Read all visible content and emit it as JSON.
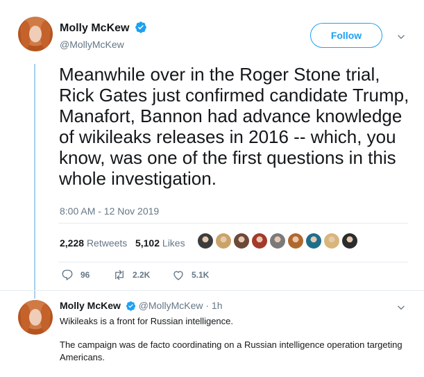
{
  "tweet": {
    "author_name": "Molly McKew",
    "author_handle": "@MollyMcKew",
    "follow_label": "Follow",
    "text": "Meanwhile over in the Roger Stone trial, Rick Gates just confirmed candidate Trump, Manafort, Bannon had advance knowledge of wikileaks releases in 2016 -- which, you know, was one of the first questions in this whole investigation.",
    "timestamp": "8:00 AM - 12 Nov 2019",
    "retweets_count": "2,228",
    "retweets_label": "Retweets",
    "likes_count": "5,102",
    "likes_label": "Likes",
    "actions": {
      "reply_count": "96",
      "retweet_count": "2.2K",
      "like_count": "5.1K"
    },
    "liker_colors": [
      "#3c3c3c",
      "#c9a36a",
      "#6b4a3a",
      "#a33a2a",
      "#7a7a7a",
      "#b0682c",
      "#1d6e8c",
      "#d8b57a",
      "#2c2c2c"
    ]
  },
  "reply": {
    "author_name": "Molly McKew",
    "author_handle": "@MollyMcKew",
    "time": "· 1h",
    "text_line1": "Wikileaks is a front for Russian intelligence.",
    "text_line2": "The campaign was de facto coordinating on a Russian intelligence operation targeting Americans."
  },
  "colors": {
    "accent": "#1da1f2",
    "secondary_text": "#657786",
    "thread_line": "#a5d0ee"
  },
  "icons": [
    "verified-badge-icon",
    "chevron-down-icon",
    "reply-icon",
    "retweet-icon",
    "like-icon"
  ]
}
